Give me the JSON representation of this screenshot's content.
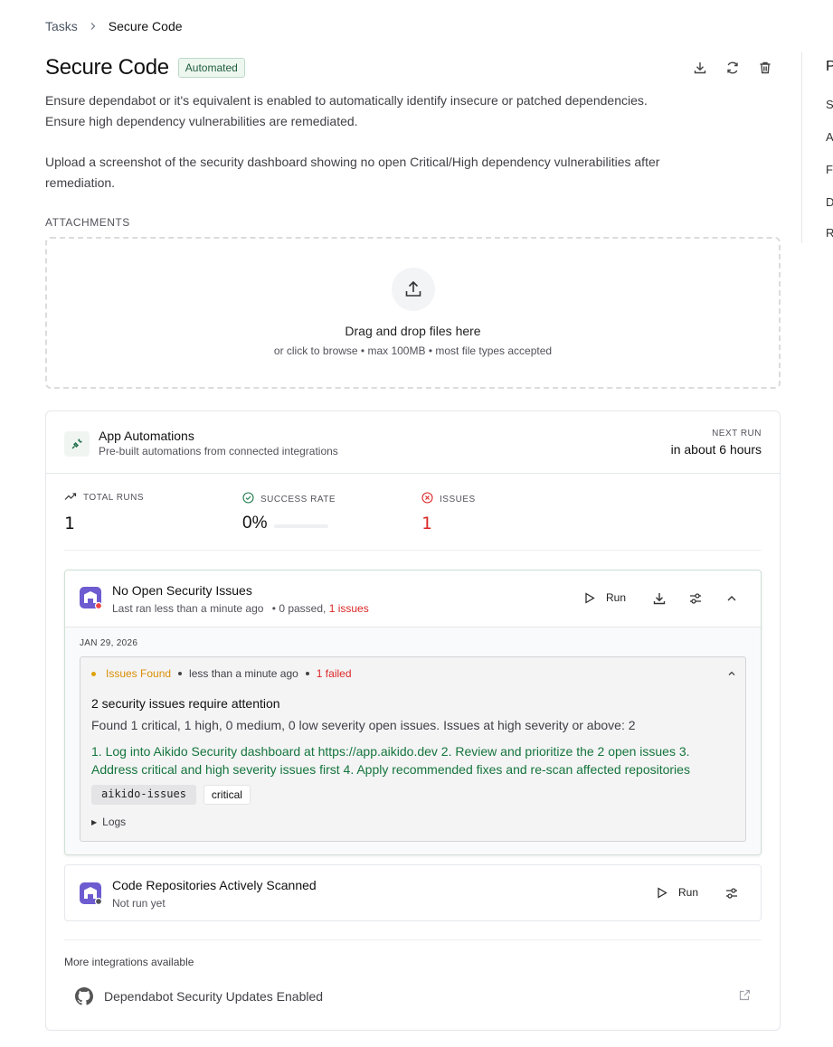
{
  "breadcrumb": {
    "parent": "Tasks",
    "current": "Secure Code"
  },
  "page": {
    "title": "Secure Code",
    "badge": "Automated",
    "description": [
      "Ensure dependabot or it's equivalent is enabled to automatically identify insecure or patched dependencies. Ensure high dependency vulnerabilities are remediated.",
      "Upload a screenshot of the security dashboard showing no open Critical/High dependency vulnerabilities after remediation."
    ],
    "actions": [
      "download-icon",
      "refresh-icon",
      "trash-icon"
    ]
  },
  "attachments": {
    "label": "ATTACHMENTS",
    "drop_title": "Drag and drop files here",
    "drop_sub": "or click to browse • max 100MB • most file types accepted"
  },
  "automations": {
    "title": "App Automations",
    "subtitle": "Pre-built automations from connected integrations",
    "next_run_label": "NEXT RUN",
    "next_run_value": "in about 6 hours",
    "stats": {
      "total_runs_label": "TOTAL RUNS",
      "total_runs_value": "1",
      "success_rate_label": "SUCCESS RATE",
      "success_rate_value": "0%",
      "success_rate_fraction": 0,
      "issues_label": "ISSUES",
      "issues_value": "1"
    },
    "items": [
      {
        "title": "No Open Security Issues",
        "meta_prefix": "Last ran less than a minute ago",
        "meta_passed": "• 0 passed,",
        "meta_issues": "1 issues",
        "run_label": "Run",
        "status_color": "#ef4444",
        "expanded": {
          "date": "JAN 29, 2026",
          "status": "Issues Found",
          "time": "less than a minute ago",
          "failed": "1 failed",
          "heading": "2 security issues require attention",
          "found": "Found 1 critical, 1 high, 0 medium, 0 low severity open issues. Issues at high severity or above: 2",
          "steps": "1. Log into Aikido Security dashboard at https://app.aikido.dev 2. Review and prioritize the 2 open issues 3. Address critical and high severity issues first 4. Apply recommended fixes and re-scan affected repositories",
          "tags": [
            "aikido-issues",
            "critical"
          ],
          "logs_label": "Logs"
        }
      },
      {
        "title": "Code Repositories Actively Scanned",
        "meta": "Not run yet",
        "run_label": "Run",
        "status_color": "#52525b"
      }
    ],
    "more_label": "More integrations available",
    "integration": {
      "name": "Dependabot Security Updates Enabled",
      "icon": "github-icon"
    }
  },
  "right_rail": {
    "head": "P",
    "items": [
      "S",
      "A",
      "Fi",
      "D",
      "R"
    ]
  },
  "colors": {
    "brand_purple": "#6d5bd0",
    "success_green": "#15753c",
    "danger_red": "#dc2626",
    "amber": "#d98e04"
  }
}
